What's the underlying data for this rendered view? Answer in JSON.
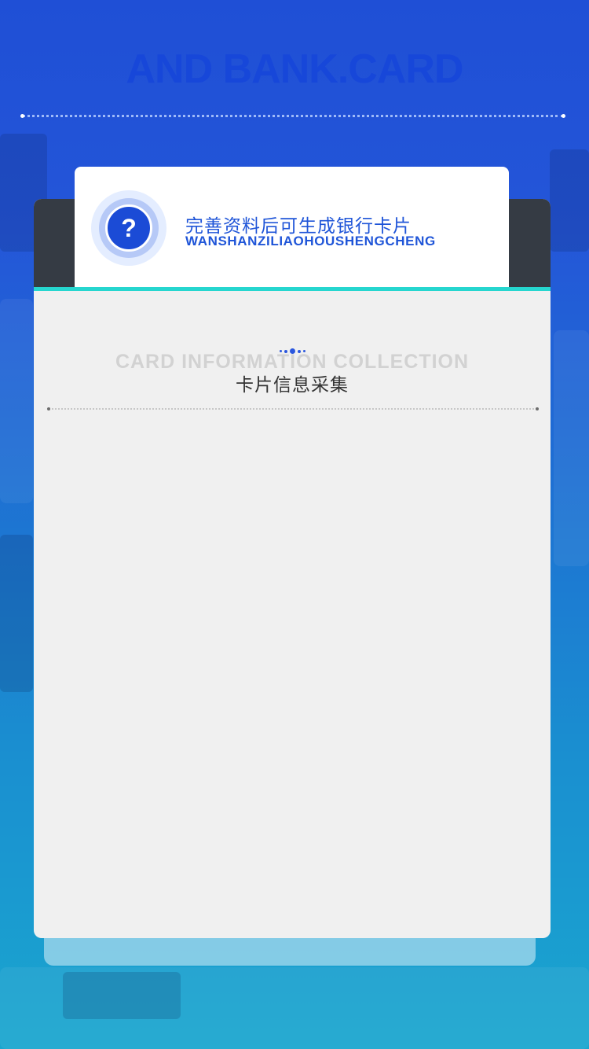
{
  "header": {
    "title": "AND BANK.CARD"
  },
  "notice": {
    "icon": "question-circle-icon",
    "title": "完善资料后可生成银行卡片",
    "subtitle": "WANSHANZILIAOHOUSHENGCHENG",
    "icon_glyph": "?"
  },
  "section": {
    "title_en": "CARD INFORMATION COLLECTION",
    "title_cn": "卡片信息采集",
    "icon": "dots-icon"
  },
  "colors": {
    "accent": "#1f55d8",
    "header_bar": "#353b44",
    "accent_line": "#26d6cf",
    "card_bg": "#f0f0f0"
  }
}
